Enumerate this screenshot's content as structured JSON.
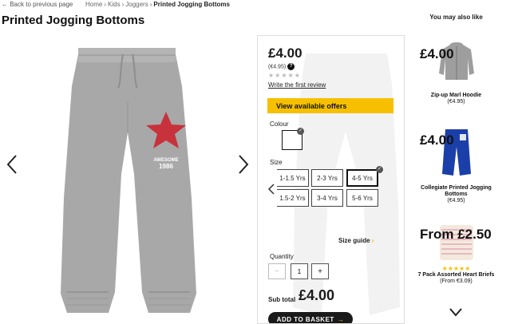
{
  "nav": {
    "back_label": "← Back to previous page",
    "breadcrumb": [
      "Home",
      "Kids",
      "Joggers",
      "Printed Jogging Bottoms"
    ]
  },
  "product": {
    "title": "Printed Jogging Bottoms",
    "price": "£4.00",
    "was_price": "(€4.95)",
    "info_icon": "?",
    "stars": "★★★★★",
    "review_link": "Write the first review",
    "offers_button": "View available offers",
    "print_text_1": "AWESOME",
    "print_text_2": "1986"
  },
  "options": {
    "colour_label": "Colour",
    "size_label": "Size",
    "sizes": [
      "1-1.5 Yrs",
      "2-3 Yrs",
      "4-5 Yrs",
      "1.5-2 Yrs",
      "3-4 Yrs",
      "5-6 Yrs"
    ],
    "selected_size": "4-5 Yrs",
    "size_guide": "Size guide",
    "size_guide_arrow": "›"
  },
  "purchase": {
    "quantity_label": "Quantity",
    "quantity_value": "1",
    "minus": "−",
    "plus": "+",
    "subtotal_label": "Sub total",
    "subtotal_value": "£4.00",
    "basket_button": "ADD TO BASKET",
    "basket_arrow": "→"
  },
  "recommendations": {
    "title": "You may also like",
    "items": [
      {
        "name": "Zip-up Marl Hoodie",
        "price": "£4.00",
        "was": "(€4.95)"
      },
      {
        "name": "Collegiate Printed Jogging Bottoms",
        "price": "£4.00",
        "was": "(€4.95)"
      },
      {
        "stars": "★★★★★",
        "name": "7 Pack Assorted Heart Briefs",
        "price": "From £2.50",
        "was": "(From €3.09)"
      }
    ]
  },
  "icons": {
    "gallery_prev": "chevron-left-icon",
    "gallery_next": "chevron-right-icon",
    "check": "check-icon",
    "recs_more": "chevron-down-icon"
  },
  "colors": {
    "accent_yellow": "#f6c000",
    "dark": "#1a1a1a",
    "product_grey": "#a8a8a8",
    "star_red": "#c8323c"
  }
}
